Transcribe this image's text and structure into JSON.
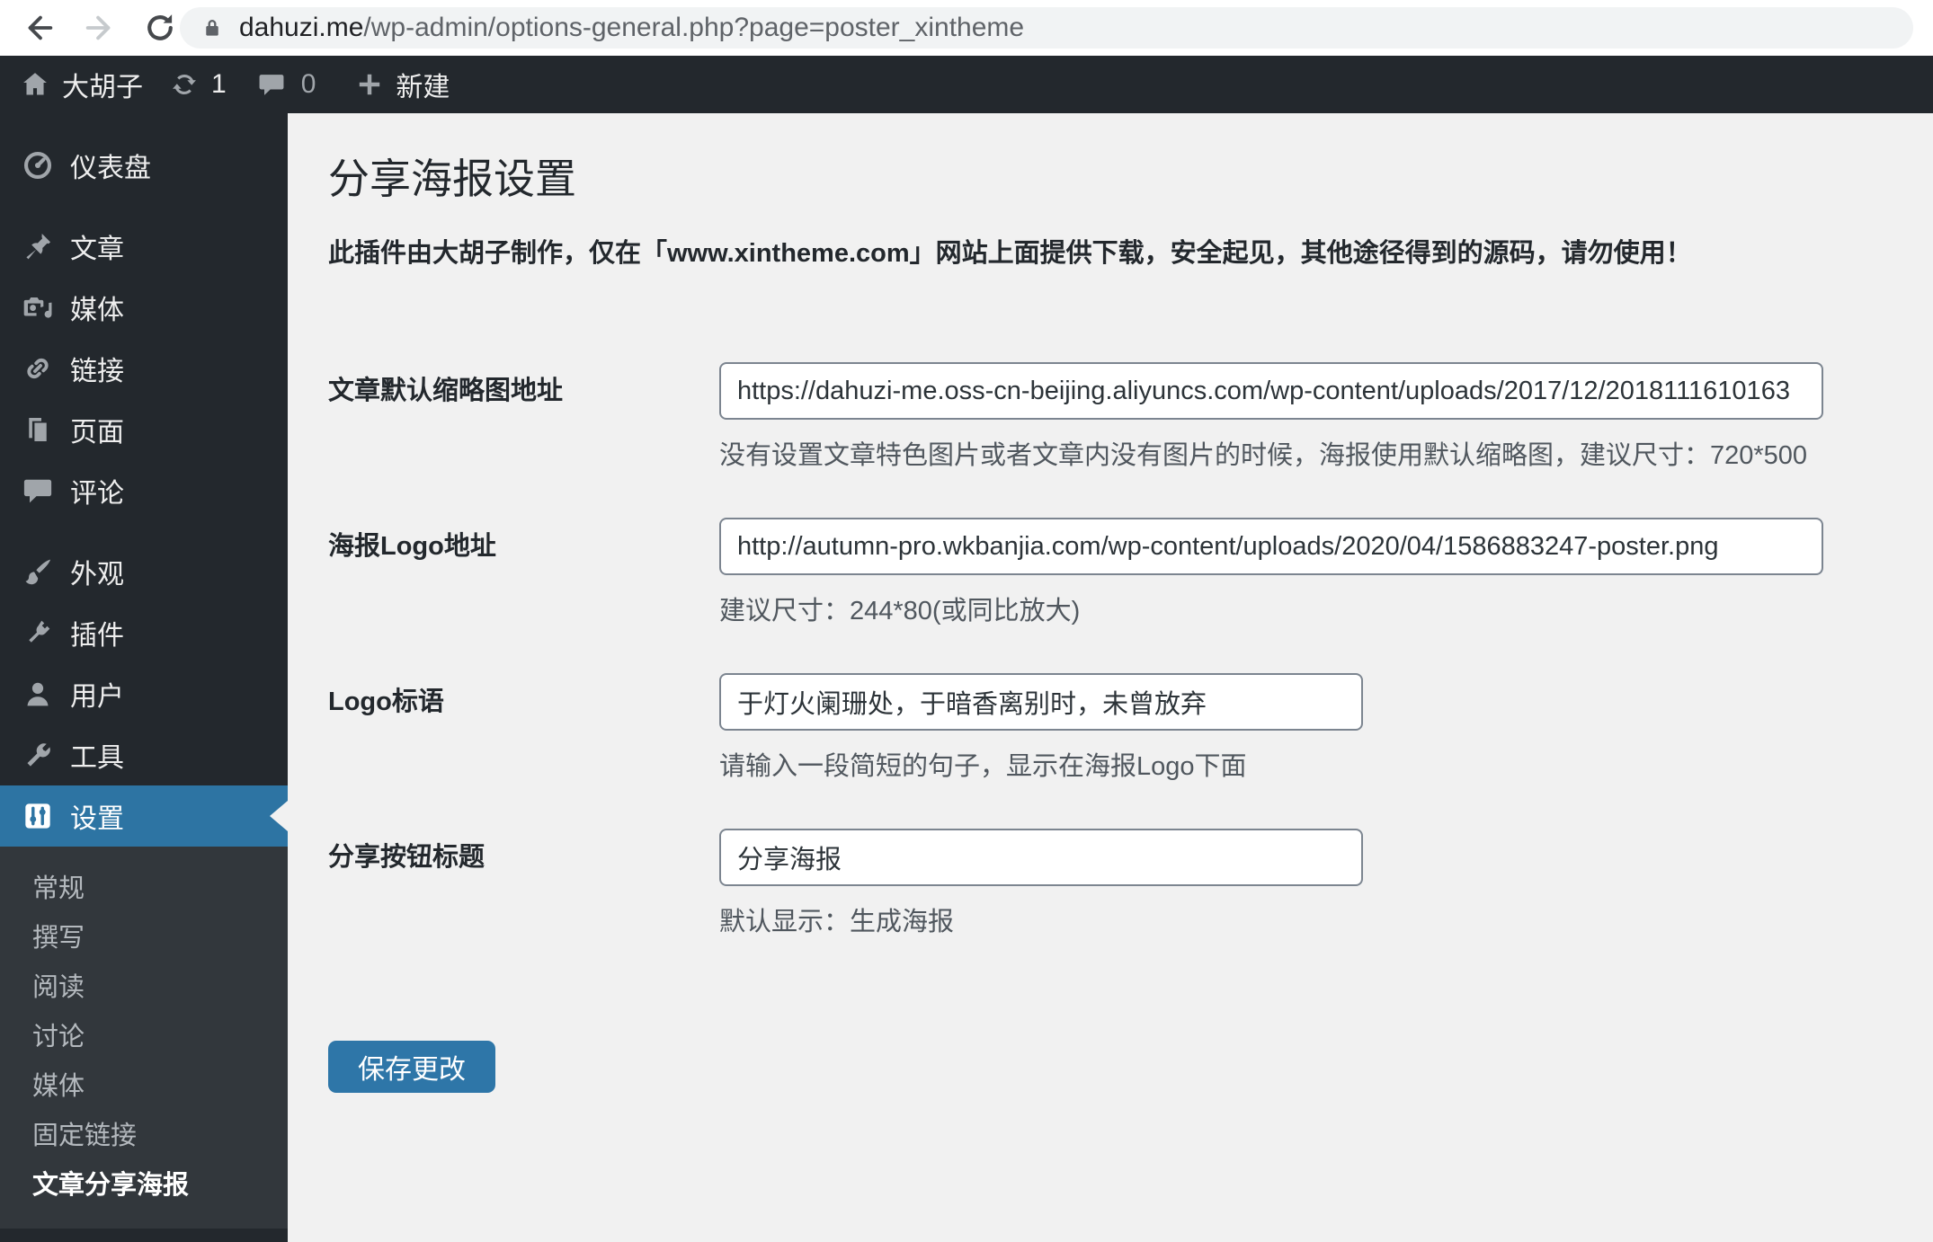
{
  "browser": {
    "url_domain": "dahuzi.me",
    "url_path": "/wp-admin/options-general.php?page=poster_xintheme"
  },
  "admin_bar": {
    "site_name": "大胡子",
    "update_count": "1",
    "comment_count": "0",
    "new_label": "新建",
    "icons": [
      "home-icon",
      "update-icon",
      "comment-icon",
      "plus-icon"
    ]
  },
  "sidebar": {
    "items": [
      {
        "label": "仪表盘",
        "icon": "gauge-icon"
      },
      {
        "label": "文章",
        "icon": "pin-icon"
      },
      {
        "label": "媒体",
        "icon": "media-icon"
      },
      {
        "label": "链接",
        "icon": "link-icon"
      },
      {
        "label": "页面",
        "icon": "pages-icon"
      },
      {
        "label": "评论",
        "icon": "comment-icon"
      },
      {
        "label": "外观",
        "icon": "brush-icon"
      },
      {
        "label": "插件",
        "icon": "plug-icon"
      },
      {
        "label": "用户",
        "icon": "user-icon"
      },
      {
        "label": "工具",
        "icon": "wrench-icon"
      },
      {
        "label": "设置",
        "icon": "settings-icon",
        "active": true
      }
    ],
    "submenu": [
      {
        "label": "常规"
      },
      {
        "label": "撰写"
      },
      {
        "label": "阅读"
      },
      {
        "label": "讨论"
      },
      {
        "label": "媒体"
      },
      {
        "label": "固定链接"
      },
      {
        "label": "文章分享海报",
        "current": true
      }
    ]
  },
  "main": {
    "title": "分享海报设置",
    "notice": "此插件由大胡子制作，仅在「www.xintheme.com」网站上面提供下载，安全起见，其他途径得到的源码，请勿使用！",
    "fields": [
      {
        "label": "文章默认缩略图地址",
        "value": "https://dahuzi-me.oss-cn-beijing.aliyuncs.com/wp-content/uploads/2017/12/2018111610163",
        "help": "没有设置文章特色图片或者文章内没有图片的时候，海报使用默认缩略图，建议尺寸：720*500"
      },
      {
        "label": "海报Logo地址",
        "value": "http://autumn-pro.wkbanjia.com/wp-content/uploads/2020/04/1586883247-poster.png",
        "help": "建议尺寸：244*80(或同比放大)"
      },
      {
        "label": "Logo标语",
        "value": "于灯火阑珊处，于暗香离别时，未曾放弃",
        "help": "请输入一段简短的句子，显示在海报Logo下面"
      },
      {
        "label": "分享按钮标题",
        "value": "分享海报",
        "help": "默认显示：生成海报"
      }
    ],
    "save_label": "保存更改"
  },
  "colors": {
    "content_bg": "#f1f1f1",
    "admin_dark": "#23282d",
    "submenu_bg": "#32373c",
    "active_blue": "#2d74a3",
    "button_blue": "#2e76a8"
  }
}
